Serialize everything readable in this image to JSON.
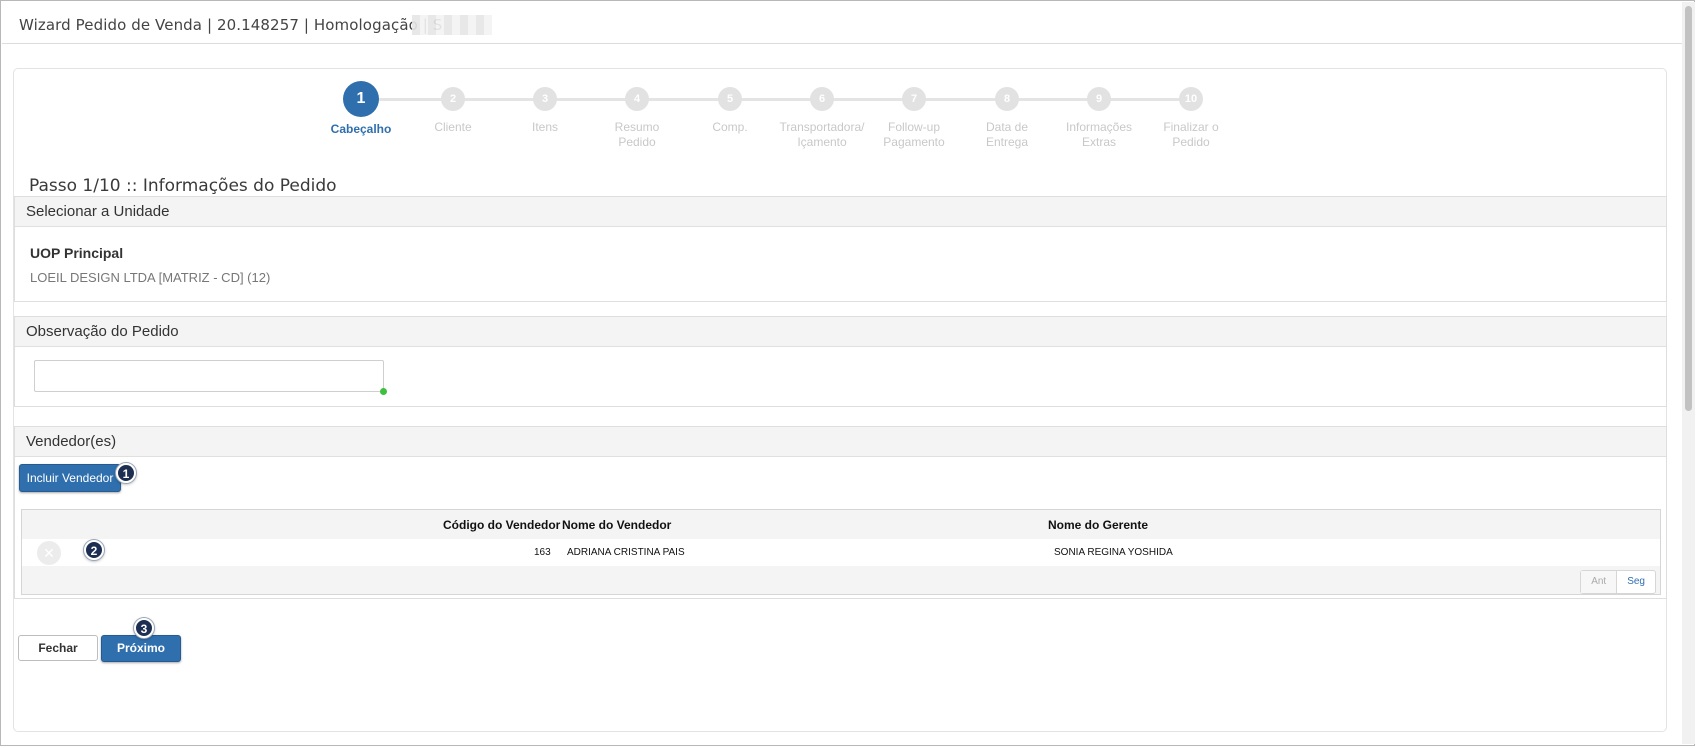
{
  "window": {
    "title": "Wizard Pedido de Venda | 20.148257 | Homologação | S"
  },
  "wizard": {
    "steps": [
      {
        "number": "1",
        "label": "Cabeçalho",
        "active": true
      },
      {
        "number": "2",
        "label": "Cliente"
      },
      {
        "number": "3",
        "label": "Itens"
      },
      {
        "number": "4",
        "label": "Resumo Pedido"
      },
      {
        "number": "5",
        "label": "Comp."
      },
      {
        "number": "6",
        "label": "Transportadora/ Içamento"
      },
      {
        "number": "7",
        "label": "Follow-up Pagamento"
      },
      {
        "number": "8",
        "label": "Data de Entrega"
      },
      {
        "number": "9",
        "label": "Informações Extras"
      },
      {
        "number": "10",
        "label": "Finalizar o Pedido"
      }
    ]
  },
  "page": {
    "title": "Passo 1/10 :: Informações do Pedido"
  },
  "unidade": {
    "heading": "Selecionar a Unidade",
    "label": "UOP Principal",
    "value": "LOEIL DESIGN LTDA [MATRIZ - CD] (12)"
  },
  "observacao": {
    "heading": "Observação do Pedido",
    "value": ""
  },
  "vendedores": {
    "heading": "Vendedor(es)",
    "add_button": "Incluir Vendedor",
    "columns": [
      "Código do Vendedor",
      "Nome do Vendedor",
      "Nome do Gerente"
    ],
    "rows": [
      {
        "codigo": "163",
        "nome": "ADRIANA CRISTINA PAIS",
        "gerente": "SONIA REGINA YOSHIDA"
      }
    ],
    "pager": {
      "prev": "Ant",
      "next": "Seg"
    }
  },
  "footer": {
    "close_button": "Fechar",
    "next_button": "Próximo"
  },
  "annotations": {
    "badge1": "1",
    "badge2": "2",
    "badge3": "3"
  },
  "icons": {
    "delete": "x-circle-icon"
  },
  "colors": {
    "primary": "#2f6fae",
    "badge": "#1c2f52",
    "step_inactive": "#e2e2e2"
  }
}
